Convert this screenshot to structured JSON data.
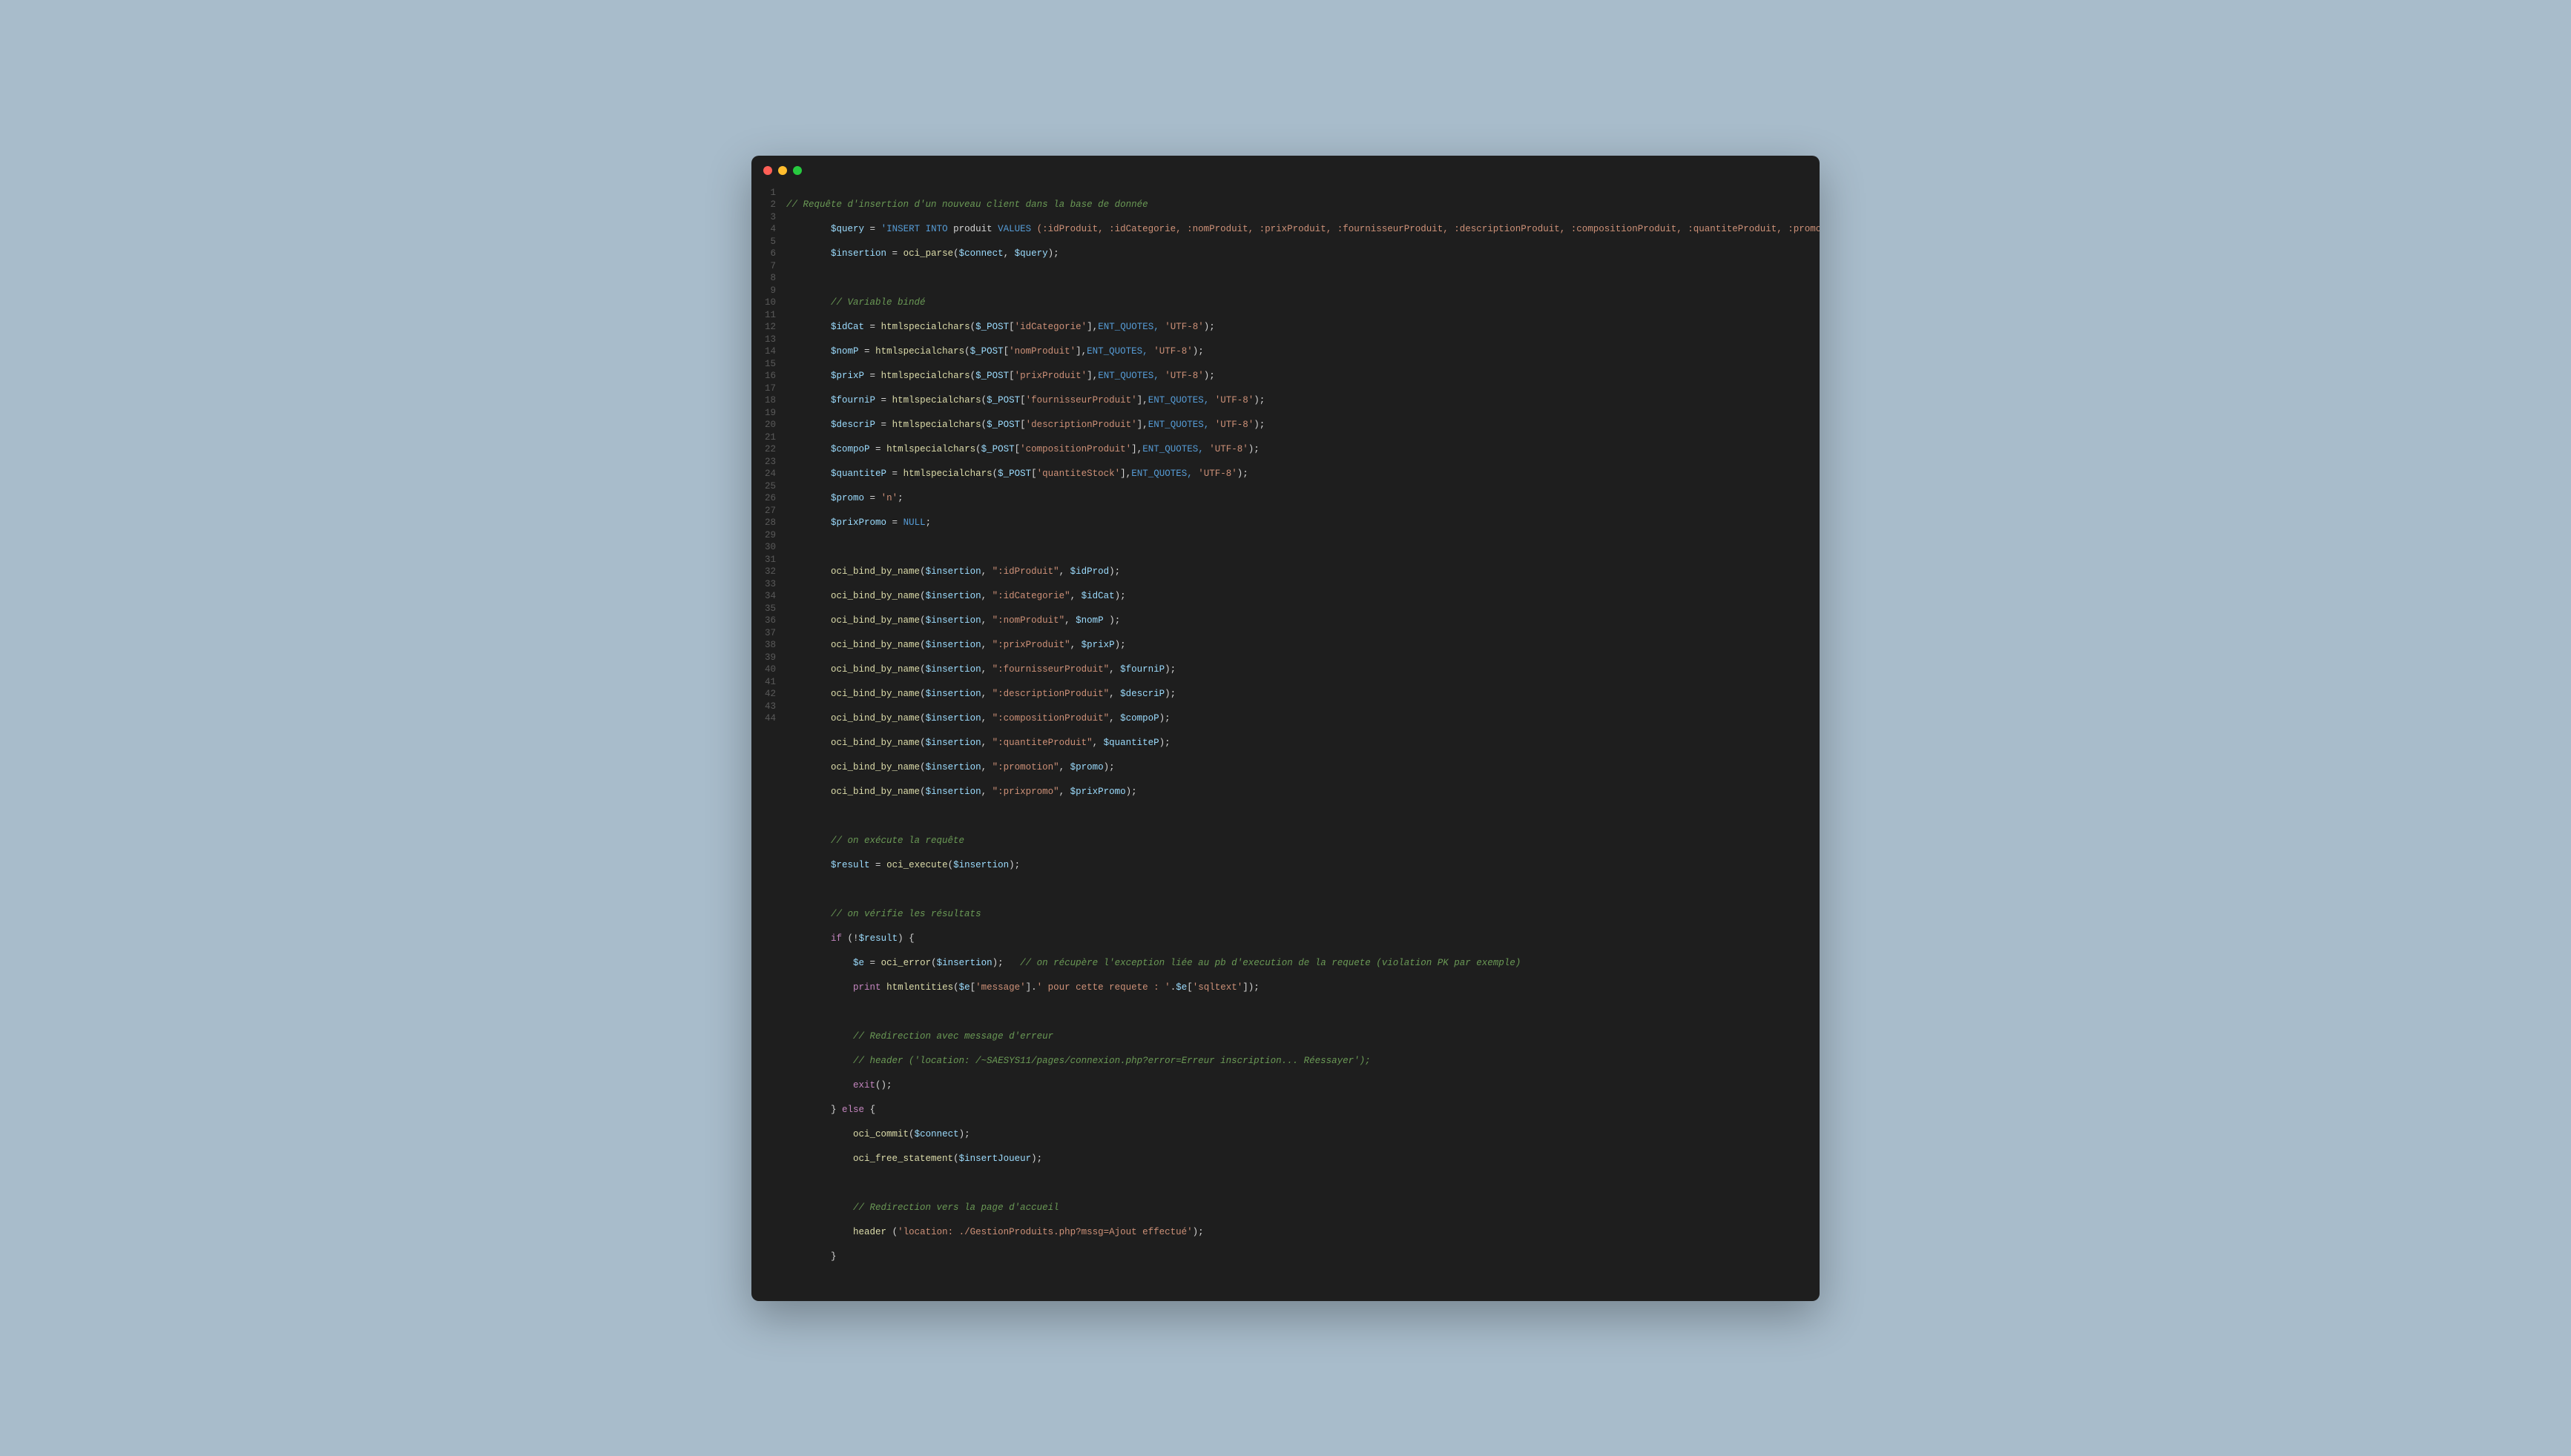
{
  "traffic": {
    "close": "close",
    "minimize": "minimize",
    "zoom": "zoom"
  },
  "lines": {
    "l1_comment": "// Requête d'insertion d'un nouveau client dans la base de donnée",
    "l2_var": "$query",
    "l2_op": " = ",
    "l2_sql_a": "'INSERT",
    "l2_sql_b": " INTO",
    "l2_sql_c": " produit ",
    "l2_sql_d": "VALUES",
    "l2_sql_e": " (:idProduit, :idCategorie, :nomProduit, :prixProduit, :fournisseurProduit, :descriptionProduit, :compositionProduit, :quantiteProduit, :promotion, :prixpromo)'",
    "l2_end": ";",
    "l3_var": "$insertion",
    "l3_op": " = ",
    "l3_fn": "oci_parse",
    "l3_args_open": "(",
    "l3_a1": "$connect",
    "l3_comma": ", ",
    "l3_a2": "$query",
    "l3_args_close": ");",
    "l5_comment": "// Variable bindé",
    "l6_var": "$idCat",
    "l6_op": " = ",
    "l6_fn": "htmlspecialchars",
    "l6_open": "(",
    "l6_post": "$_POST",
    "l6_br_open": "[",
    "l6_key": "'idCategorie'",
    "l6_br_close": "],",
    "l6_entq": "ENT_QUOTES, ",
    "l6_utf": "'UTF-8'",
    "l6_close": ");",
    "l7_var": "$nomP",
    "l7_key": "'nomProduit'",
    "l8_var": "$prixP",
    "l8_key": "'prixProduit'",
    "l9_var": "$fourniP",
    "l9_key": "'fournisseurProduit'",
    "l10_var": "$descriP",
    "l10_key": "'descriptionProduit'",
    "l11_var": "$compoP",
    "l11_key": "'compositionProduit'",
    "l12_var": "$quantiteP",
    "l12_key": "'quantiteStock'",
    "l13_var": "$promo",
    "l13_op": " = ",
    "l13_val": "'n'",
    "l13_end": ";",
    "l14_var": "$prixPromo",
    "l14_op": " = ",
    "l14_null": "NULL",
    "l14_end": ";",
    "bind_fn": "oci_bind_by_name",
    "bind_open": "(",
    "bind_ins": "$insertion",
    "bind_comma": ", ",
    "bind_close": ");",
    "l16_param": "\":idProduit\"",
    "l16_val": "$idProd",
    "l17_param": "\":idCategorie\"",
    "l17_val": "$idCat",
    "l18_param": "\":nomProduit\"",
    "l18_val": "$nomP",
    "l18_space": " ",
    "l19_param": "\":prixProduit\"",
    "l19_val": "$prixP",
    "l20_param": "\":fournisseurProduit\"",
    "l20_val": "$fourniP",
    "l21_param": "\":descriptionProduit\"",
    "l21_val": "$descriP",
    "l22_param": "\":compositionProduit\"",
    "l22_val": "$compoP",
    "l23_param": "\":quantiteProduit\"",
    "l23_val": "$quantiteP",
    "l24_param": "\":promotion\"",
    "l24_val": "$promo",
    "l25_param": "\":prixpromo\"",
    "l25_val": "$prixPromo",
    "l27_comment": "// on exécute la requête",
    "l28_var": "$result",
    "l28_op": " = ",
    "l28_fn": "oci_execute",
    "l28_open": "(",
    "l28_arg": "$insertion",
    "l28_close": ");",
    "l30_comment": "// on vérifie les résultats",
    "l31_if": "if",
    "l31_open": " (!",
    "l31_var": "$result",
    "l31_close": ") {",
    "l32_var": "$e",
    "l32_op": " = ",
    "l32_fn": "oci_error",
    "l32_open": "(",
    "l32_arg": "$insertion",
    "l32_close": ");",
    "l32_sp": "   ",
    "l32_comment": "// on récupère l'exception liée au pb d'execution de la requete (violation PK par exemple)",
    "l33_print": "print",
    "l33_sp": " ",
    "l33_fn": "htmlentities",
    "l33_open": "(",
    "l33_e": "$e",
    "l33_br1": "[",
    "l33_k1": "'message'",
    "l33_br1c": "].",
    "l33_mid": "' pour cette requete : '",
    "l33_dot": ".",
    "l33_e2": "$e",
    "l33_br2": "[",
    "l33_k2": "'sqltext'",
    "l33_br2c": "]);",
    "l35_comment": "// Redirection avec message d'erreur",
    "l36_comment": "// header ('location: /~SAESYS11/pages/connexion.php?error=Erreur inscription... Réessayer');",
    "l37_exit": "exit",
    "l37_par": "();",
    "l38_close": "} ",
    "l38_else": "else",
    "l38_open": " {",
    "l39_fn": "oci_commit",
    "l39_open": "(",
    "l39_arg": "$connect",
    "l39_close": ");",
    "l40_fn": "oci_free_statement",
    "l40_open": "(",
    "l40_arg": "$insertJoueur",
    "l40_close": ");",
    "l42_comment": "// Redirection vers la page d'accueil",
    "l43_fn": "header",
    "l43_sp": " ",
    "l43_open": "(",
    "l43_str": "'location: ./GestionProduits.php?mssg=Ajout effectué'",
    "l43_close": ");",
    "l44_brace": "}"
  },
  "line_numbers": [
    "1",
    "2",
    "3",
    "4",
    "5",
    "6",
    "7",
    "8",
    "9",
    "10",
    "11",
    "12",
    "13",
    "14",
    "15",
    "16",
    "17",
    "18",
    "19",
    "20",
    "21",
    "22",
    "23",
    "24",
    "25",
    "26",
    "27",
    "28",
    "29",
    "30",
    "31",
    "32",
    "33",
    "34",
    "35",
    "36",
    "37",
    "38",
    "39",
    "40",
    "41",
    "42",
    "43",
    "44"
  ]
}
